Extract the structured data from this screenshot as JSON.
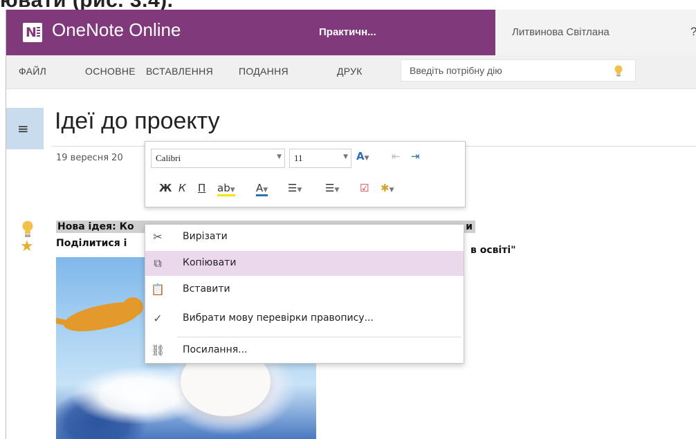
{
  "doc_heading": "ювати (рис. 3.4).",
  "app": {
    "name": "OneNote Online",
    "notebook": "Практичн...",
    "user": "Литвинова Світлана",
    "help": "?"
  },
  "ribbon": {
    "tabs": [
      "ФАЙЛ",
      "ОСНОВНЕ",
      "ВСТАВЛЕННЯ",
      "ПОДАННЯ",
      "ДРУК"
    ],
    "tell_placeholder": "Введіть потрібну дію"
  },
  "page": {
    "title": "Ідеї до проекту",
    "date": "19 вересня 20",
    "line1": "Нова ідея: Ко",
    "line1_end": "и",
    "line2": "Поділитися і",
    "line2_tail": "в освіті\""
  },
  "mini_toolbar": {
    "font": "Calibri",
    "size": "11",
    "bold": "Ж",
    "italic": "К",
    "underline": "П"
  },
  "context_menu": {
    "items": [
      "Вирізати",
      "Копіювати",
      "Вставити",
      "Вибрати мову перевірки правопису...",
      "Посилання..."
    ]
  },
  "colors": {
    "brand": "#80397b",
    "highlight": "#ecd8ec",
    "menu_button": "#c9dced"
  }
}
